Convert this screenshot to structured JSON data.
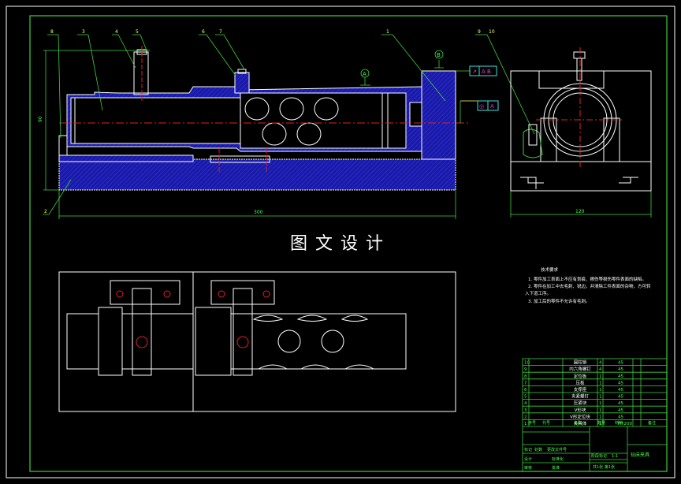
{
  "title": "图文设计",
  "balloons": [
    "8",
    "3",
    "4",
    "5",
    "6",
    "7",
    "1",
    "9",
    "10",
    "2"
  ],
  "datum_labels": [
    "A",
    "B"
  ],
  "tolerance_frames": [
    [
      "↗",
      "A B"
    ],
    [
      "◎",
      "A"
    ]
  ],
  "dimensions": {
    "height": "90",
    "length": "300",
    "side_width": "120"
  },
  "tech_req": {
    "heading": "技术要求",
    "lines": [
      "1. 零件加工表面上不应有划痕、擦伤等损伤零件表面的缺陷。",
      "2. 零件在加工中去毛刺、锐边，并清除工件表面的杂物，方可转",
      "入下道工序。",
      "3. 加工后的零件不允许有毛刺。"
    ]
  },
  "parts": [
    {
      "no": "10",
      "name": "圆柱销",
      "qty": "4",
      "mat": "45"
    },
    {
      "no": "9",
      "name": "内六角螺钉",
      "qty": "4",
      "mat": "45"
    },
    {
      "no": "8",
      "name": "定位板",
      "qty": "1",
      "mat": "45"
    },
    {
      "no": "7",
      "name": "压板",
      "qty": "1",
      "mat": "45"
    },
    {
      "no": "6",
      "name": "支撑座",
      "qty": "1",
      "mat": "45"
    },
    {
      "no": "5",
      "name": "夹紧螺钉",
      "qty": "1",
      "mat": "45"
    },
    {
      "no": "4",
      "name": "压紧块",
      "qty": "1",
      "mat": "45"
    },
    {
      "no": "3",
      "name": "V形块",
      "qty": "1",
      "mat": "45"
    },
    {
      "no": "2",
      "name": "V形定位块",
      "qty": "1",
      "mat": "45"
    },
    {
      "no": "1",
      "name": "夹具体",
      "qty": "1",
      "mat": "HT200"
    }
  ],
  "parts_header": [
    "序号",
    "代号",
    "名称",
    "数量",
    "材料",
    "备注"
  ],
  "title_block": {
    "drawing_name": "钻床夹具",
    "scale": "1:1",
    "sheet": "共1张 第1张",
    "labels": [
      "标记",
      "处数",
      "分区",
      "更改文件号",
      "签名",
      "年月日",
      "设计",
      "标准化",
      "审核",
      "工艺",
      "批准",
      "阶段标记",
      "重量",
      "比例"
    ]
  }
}
